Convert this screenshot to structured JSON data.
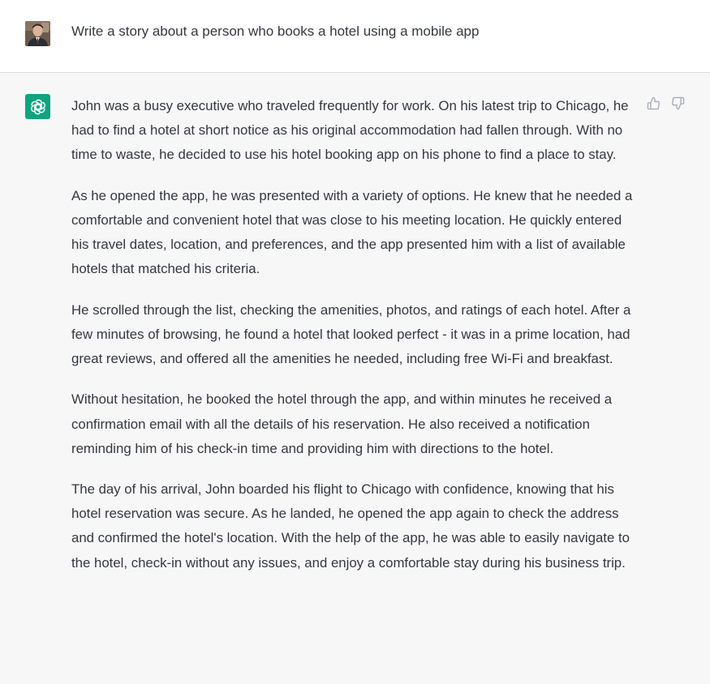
{
  "user": {
    "avatar_icon": "user-avatar",
    "message": "Write a story about a person who books a hotel using a mobile app"
  },
  "assistant": {
    "avatar_icon": "openai-logo",
    "accent": "#10a37f",
    "paragraphs": [
      "John was a busy executive who traveled frequently for work. On his latest trip to Chicago, he had to find a hotel at short notice as his original accommodation had fallen through. With no time to waste, he decided to use his hotel booking app on his phone to find a place to stay.",
      "As he opened the app, he was presented with a variety of options. He knew that he needed a comfortable and convenient hotel that was close to his meeting location. He quickly entered his travel dates, location, and preferences, and the app presented him with a list of available hotels that matched his criteria.",
      "He scrolled through the list, checking the amenities, photos, and ratings of each hotel. After a few minutes of browsing, he found a hotel that looked perfect - it was in a prime location, had great reviews, and offered all the amenities he needed, including free Wi-Fi and breakfast.",
      "Without hesitation, he booked the hotel through the app, and within minutes he received a confirmation email with all the details of his reservation. He also received a notification reminding him of his check-in time and providing him with directions to the hotel.",
      "The day of his arrival, John boarded his flight to Chicago with confidence, knowing that his hotel reservation was secure. As he landed, he opened the app again to check the address and confirmed the hotel's location. With the help of the app, he was able to easily navigate to the hotel, check-in without any issues, and enjoy a comfortable stay during his business trip."
    ],
    "feedback": {
      "up_icon": "thumbs-up-icon",
      "down_icon": "thumbs-down-icon"
    }
  }
}
